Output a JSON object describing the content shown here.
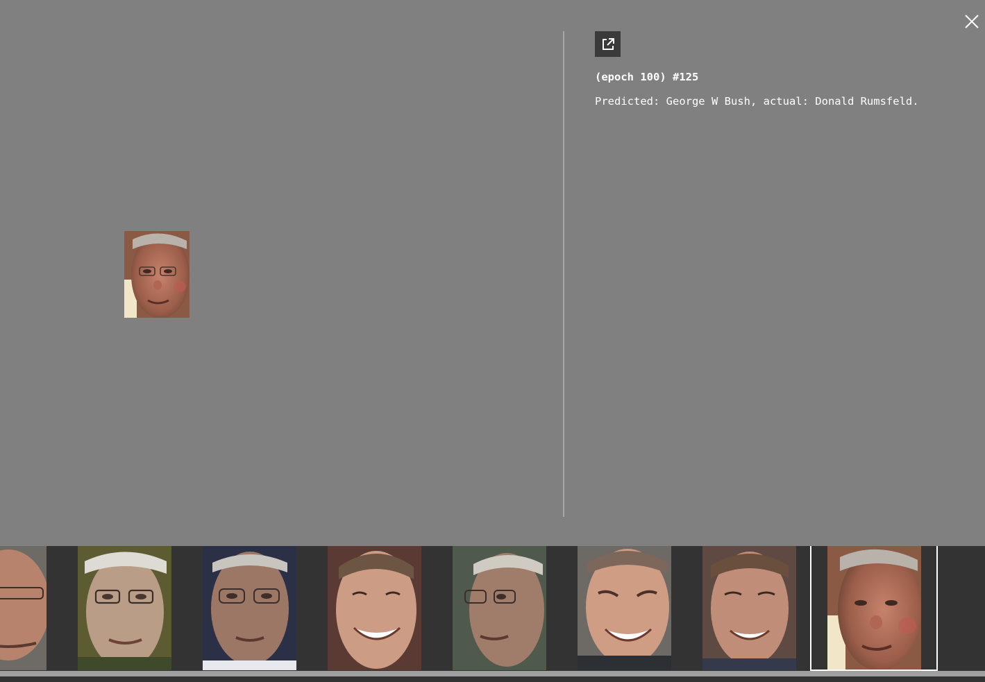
{
  "viewer": {
    "title": "(epoch 100) #125",
    "caption": "Predicted: George W Bush, actual: Donald Rumsfeld.",
    "close_icon": "close-icon",
    "open_icon": "external-link-icon"
  },
  "colors": {
    "background": "#808080",
    "filmstrip": "#333333",
    "open_button": "#3a3a3a",
    "selected_frame": "#ffffff"
  },
  "filmstrip": {
    "thumbnails": [
      {
        "alt": "face thumbnail 1"
      },
      {
        "alt": "face thumbnail 2"
      },
      {
        "alt": "face thumbnail 3"
      },
      {
        "alt": "face thumbnail 4"
      },
      {
        "alt": "face thumbnail 5"
      },
      {
        "alt": "face thumbnail 6"
      },
      {
        "alt": "face thumbnail 7"
      },
      {
        "alt": "face thumbnail 8"
      }
    ],
    "selected_index": 7
  }
}
